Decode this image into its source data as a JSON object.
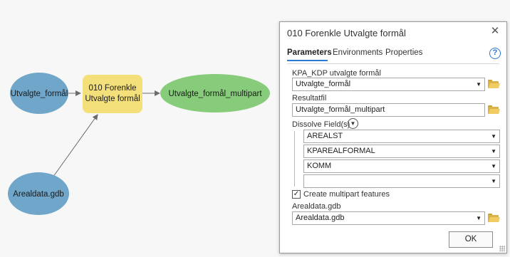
{
  "model": {
    "nodes": {
      "input1": "Utvalgte_formål",
      "tool_line1": "010 Forenkle",
      "tool_line2": "Utvalgte formål",
      "output": "Utvalgte_formål_multipart",
      "input2": "Arealdata.gdb"
    },
    "colors": {
      "input": "#6fa6c9",
      "tool": "#f3e07a",
      "output": "#86cc7a"
    }
  },
  "dialog": {
    "title": "010 Forenkle Utvalgte formål",
    "tabs": [
      "Parameters",
      "Environments",
      "Properties"
    ],
    "params": {
      "p1_label": "KPA_KDP utvalgte formål",
      "p1_value": "Utvalgte_formål",
      "p2_label": "Resultatfil",
      "p2_value": "Utvalgte_formål_multipart",
      "dissolve_label": "Dissolve Field(s)",
      "dissolve_fields": [
        "AREALST",
        "KPAREALFORMAL",
        "KOMM",
        ""
      ],
      "multipart_label": "Create multipart features",
      "multipart_checked": true,
      "p4_label": "Arealdata.gdb",
      "p4_value": "Arealdata.gdb"
    },
    "ok_label": "OK",
    "accent": "#2b7bd3"
  }
}
